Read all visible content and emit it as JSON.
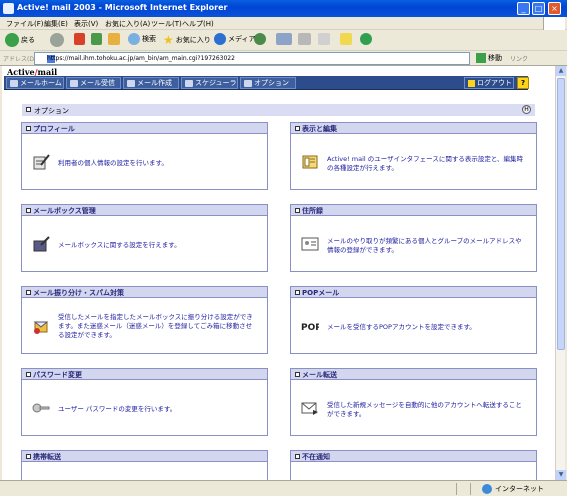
{
  "window": {
    "title": "Active! mail 2003 - Microsoft Internet Explorer",
    "buttons": [
      "_",
      "□",
      "×"
    ]
  },
  "menubar": {
    "items": [
      "ファイル(F)",
      "編集(E)",
      "表示(V)",
      "お気に入り(A)",
      "ツール(T)",
      "ヘルプ(H)"
    ]
  },
  "toolbar": {
    "back": "戻る",
    "search": "検索",
    "favorites": "お気に入り",
    "media": "メディア"
  },
  "address": {
    "label": "アドレス(D)",
    "url": "https://mail.ihm.tohoku.ac.jp/am_bin/am_main.cgi?197263022",
    "go": "移動",
    "links": "リンク"
  },
  "status": {
    "zone": "インターネット"
  },
  "app": {
    "logo_text": "Active",
    "logo_suffix": "mail",
    "nav": [
      {
        "label": "メールホーム"
      },
      {
        "label": "メール受信"
      },
      {
        "label": "メール作成"
      },
      {
        "label": "スケジューラ"
      },
      {
        "label": "オプション"
      }
    ],
    "logout": "ログアウト",
    "help": "?",
    "section_title": "オプション",
    "section_help": "H"
  },
  "panels": [
    {
      "title": "プロフィール",
      "desc": "利用者の個人情報の設定を行います。",
      "icon": "profile-icon"
    },
    {
      "title": "表示と編集",
      "desc": "Active! mail のユーザインタフェースに関する表示設定と、編集時の各種設定が行えます。",
      "icon": "display-edit-icon"
    },
    {
      "title": "メールボックス管理",
      "desc": "メールボックスに関する設定を行えます。",
      "icon": "mailbox-icon"
    },
    {
      "title": "住所録",
      "desc": "メールのやり取りが頻繁にある個人とグループのメールアドレスや情報の登録ができます。",
      "icon": "address-book-icon"
    },
    {
      "title": "メール振り分け・スパム対策",
      "desc": "受信したメールを指定したメールボックスに振り分ける設定ができます。また迷惑メール（迷惑メール）を登録してごみ箱に移動させる設定ができます。",
      "icon": "filter-icon"
    },
    {
      "title": "POPメール",
      "desc": "メールを受信するPOPアカウントを設定できます。",
      "icon": "pop-icon"
    },
    {
      "title": "パスワード変更",
      "desc": "ユーザー パスワードの変更を行います。",
      "icon": "key-icon"
    },
    {
      "title": "メール転送",
      "desc": "受信した新規メッセージを自動的に他のアカウントへ転送することができます。",
      "icon": "forward-icon"
    },
    {
      "title": "携帯転送",
      "desc": "",
      "icon": ""
    },
    {
      "title": "不在通知",
      "desc": "",
      "icon": ""
    }
  ],
  "colors": {
    "nav_bg": "#2c4c8c",
    "panel_header": "#d3d6ef",
    "panel_border": "#8b90c4",
    "desc_text": "#1c1ca0"
  }
}
